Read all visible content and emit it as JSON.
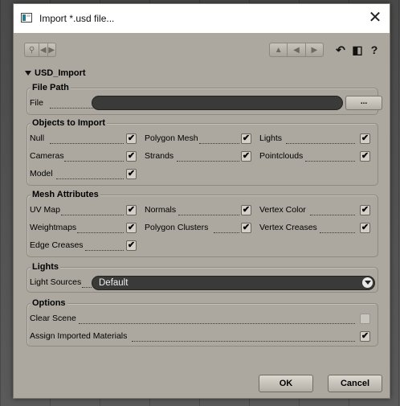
{
  "window": {
    "title": "Import *.usd file..."
  },
  "section": {
    "title": "USD_Import"
  },
  "file_path": {
    "group_title": "File Path",
    "file_label": "File",
    "file_value": "",
    "browse_label": "..."
  },
  "objects": {
    "group_title": "Objects to Import",
    "items": [
      {
        "label": "Null",
        "checked": true
      },
      {
        "label": "Polygon Mesh",
        "checked": true
      },
      {
        "label": "Lights",
        "checked": true
      },
      {
        "label": "Cameras",
        "checked": true
      },
      {
        "label": "Strands",
        "checked": true
      },
      {
        "label": "Pointclouds",
        "checked": true
      },
      {
        "label": "Model",
        "checked": true
      }
    ]
  },
  "mesh": {
    "group_title": "Mesh Attributes",
    "items": [
      {
        "label": "UV Map",
        "checked": true
      },
      {
        "label": "Normals",
        "checked": true
      },
      {
        "label": "Vertex Color",
        "checked": true
      },
      {
        "label": "Weightmaps",
        "checked": true
      },
      {
        "label": "Polygon Clusters",
        "checked": true
      },
      {
        "label": "Vertex Creases",
        "checked": true
      },
      {
        "label": "Edge Creases",
        "checked": true
      }
    ]
  },
  "lights": {
    "group_title": "Lights",
    "sources_label": "Light Sources",
    "sources_value": "Default"
  },
  "options": {
    "group_title": "Options",
    "items": [
      {
        "label": "Clear Scene",
        "checked": false
      },
      {
        "label": "Assign Imported Materials",
        "checked": true
      }
    ]
  },
  "buttons": {
    "ok": "OK",
    "cancel": "Cancel"
  },
  "icons": {
    "app": "app-window-icon",
    "close": "close-icon",
    "search": "magnifier-icon",
    "nav": "arrow-left-right-icon",
    "layout": "arrow-up-left-right-icon",
    "undo": "undo-icon",
    "save": "save-preset-icon",
    "help": "help-icon"
  }
}
